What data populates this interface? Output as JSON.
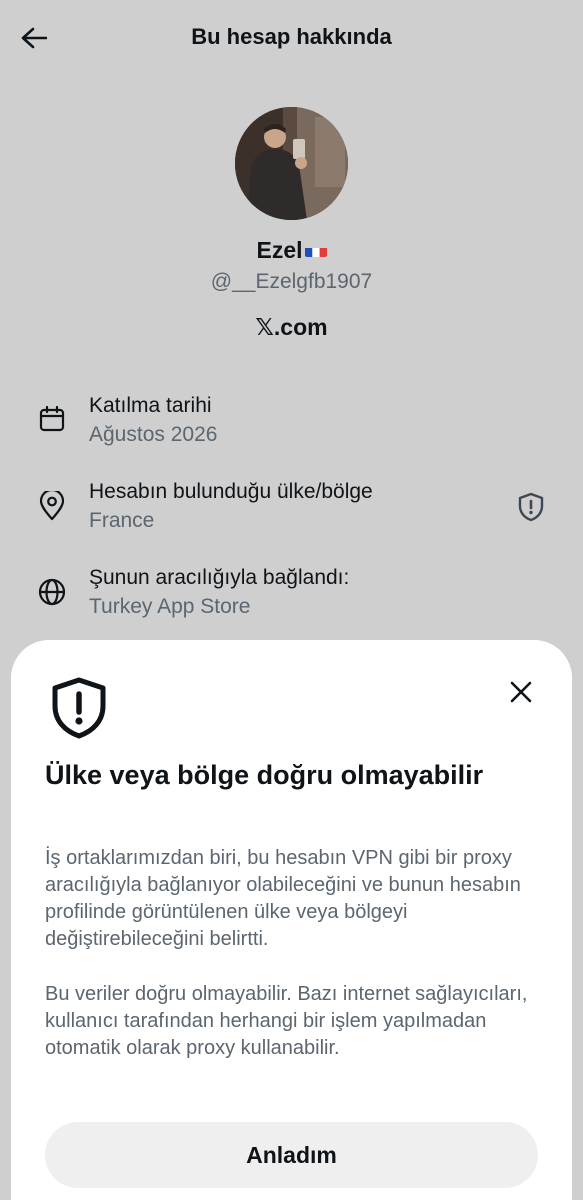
{
  "header": {
    "title": "Bu hesap hakkında",
    "back_icon": "arrow-left-icon"
  },
  "profile": {
    "display_name": "Ezel",
    "flag_icon": "flag-france-icon",
    "handle": "@__Ezelgfb1907",
    "site": "𝕏.com"
  },
  "info": {
    "joined": {
      "label": "Katılma tarihi",
      "value": "Ağustos 2026",
      "icon": "calendar-icon"
    },
    "location": {
      "label": "Hesabın bulunduğu ülke/bölge",
      "value": "France",
      "icon": "location-pin-icon",
      "warn_icon": "shield-warning-icon"
    },
    "connected": {
      "label": "Şunun aracılığıyla bağlandı:",
      "value": "Turkey App Store",
      "icon": "globe-icon"
    }
  },
  "sheet": {
    "title": "Ülke veya bölge doğru olmayabilir",
    "paragraph1": "İş ortaklarımızdan biri, bu hesabın VPN gibi bir proxy aracılığıyla bağlanıyor olabileceğini ve bunun hesabın profilinde görüntülenen ülke veya bölgeyi değiştirebileceğini belirtti.",
    "paragraph2": "Bu veriler doğru olmayabilir. Bazı internet sağlayıcıları, kullanıcı tarafından herhangi bir işlem yapılmadan otomatik olarak proxy kullanabilir.",
    "button_label": "Anladım",
    "close_icon": "close-icon",
    "shield_icon": "shield-warning-icon"
  },
  "colors": {
    "background": "#cfcfcf",
    "sheet": "#ffffff",
    "primary_text": "#0f1419",
    "secondary_text": "#5b6670",
    "button_bg": "#efefef"
  }
}
